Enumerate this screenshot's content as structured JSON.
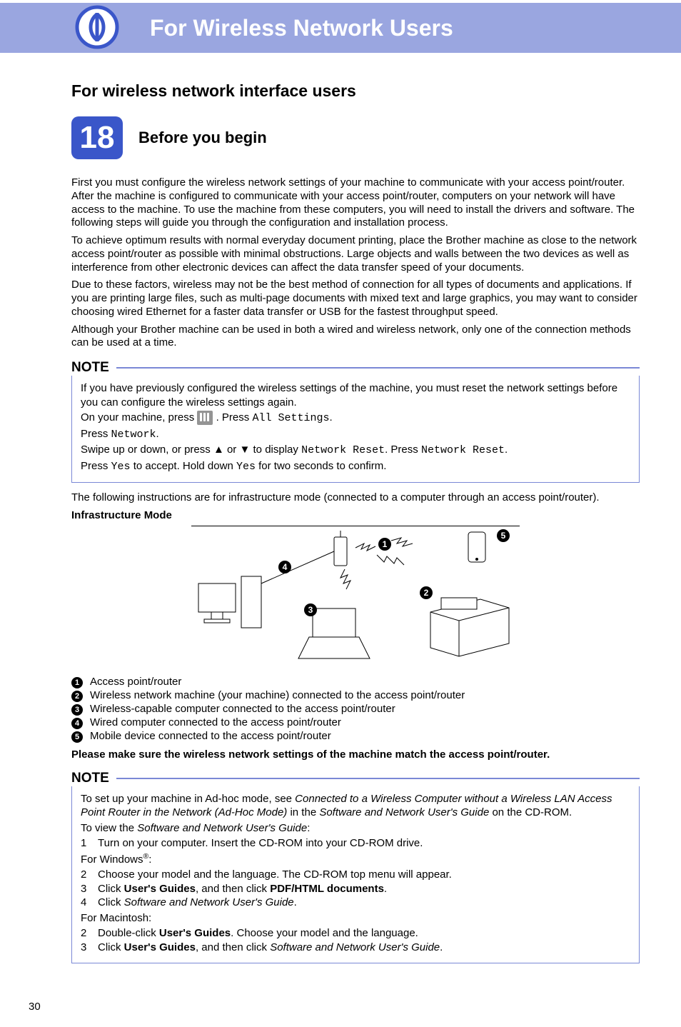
{
  "banner": {
    "title": "For Wireless Network Users"
  },
  "subtitle": "For wireless network interface users",
  "step": {
    "number": "18",
    "title": "Before you begin"
  },
  "paras": {
    "p1": "First you must configure the wireless network settings of your machine to communicate with your access point/router. After the machine is configured to communicate with your access point/router, computers on your network will have access to the machine. To use the machine from these computers, you will need to install the drivers and software. The following steps will guide you through the configuration and installation process.",
    "p2": "To achieve optimum results with normal everyday document printing, place the Brother machine as close to the network access point/router as possible with minimal obstructions. Large objects and walls between the two devices as well as interference from other electronic devices can affect the data transfer speed of your documents.",
    "p3": "Due to these factors, wireless may not be the best method of connection for all types of documents and applications. If you are printing large files, such as multi-page documents with mixed text and large graphics, you may want to consider choosing wired Ethernet for a faster data transfer or USB for the fastest throughput speed.",
    "p4": "Although your Brother machine can be used in both a wired and wireless network, only one of the connection methods can be used at a time."
  },
  "note1": {
    "label": "NOTE",
    "l1": "If you have previously configured the wireless settings of the machine, you must reset the network settings before you can configure the wireless settings again.",
    "l2a": "On your machine, press ",
    "l2b": ". Press ",
    "l2c": "All Settings",
    "l2d": ".",
    "l3a": "Press ",
    "l3b": "Network",
    "l3c": ".",
    "l4a": "Swipe up or down, or press ",
    "l4b": " or ",
    "l4c": " to display ",
    "l4d": "Network Reset",
    "l4e": ". Press ",
    "l4f": "Network Reset",
    "l4g": ".",
    "l5a": "Press ",
    "l5b": "Yes",
    "l5c": " to accept. Hold down ",
    "l5d": "Yes",
    "l5e": " for two seconds to confirm.",
    "up": "▲",
    "down": "▼"
  },
  "after_note": "The following instructions are for infrastructure mode (connected to a computer through an access point/router).",
  "infra_heading": "Infrastructure Mode",
  "callouts": {
    "c1": "1",
    "c2": "2",
    "c3": "3",
    "c4": "4",
    "c5": "5"
  },
  "legend": {
    "i1": "Access point/router",
    "i2": "Wireless network machine (your machine) connected to the access point/router",
    "i3": "Wireless-capable computer connected to the access point/router",
    "i4": "Wired computer connected to the access point/router",
    "i5": "Mobile device connected to the access point/router"
  },
  "match_line": "Please make sure the wireless network settings of the machine match the access point/router.",
  "note2": {
    "label": "NOTE",
    "adhoc_a": "To set up your machine in Ad-hoc mode, see ",
    "adhoc_b": "Connected to a Wireless Computer without a Wireless LAN Access Point Router in the Network (Ad-Hoc Mode)",
    "adhoc_c": " in the ",
    "adhoc_d": "Software and Network User's Guide",
    "adhoc_e": " on the CD-ROM.",
    "view_a": "To view the ",
    "view_b": "Software and Network User's Guide",
    "view_c": ":",
    "s1n": "1",
    "s1": "Turn on your computer. Insert the CD-ROM into your CD-ROM drive.",
    "forwin": "For Windows",
    "forwin_sup": "®",
    "forwin_colon": ":",
    "s2n": "2",
    "s2": "Choose your model and the language. The CD-ROM top menu will appear.",
    "s3n": "3",
    "s3a": "Click ",
    "s3b": "User's Guides",
    "s3c": ", and then click ",
    "s3d": "PDF/HTML documents",
    "s3e": ".",
    "s4n": "4",
    "s4a": "Click ",
    "s4b": "Software and Network User's Guide",
    "s4c": ".",
    "formac": "For Macintosh:",
    "m2n": "2",
    "m2a": "Double-click ",
    "m2b": "User's Guides",
    "m2c": ". Choose your model and the language.",
    "m3n": "3",
    "m3a": "Click ",
    "m3b": "User's Guides",
    "m3c": ", and then click ",
    "m3d": "Software and Network User's Guide",
    "m3e": "."
  },
  "page_number": "30"
}
